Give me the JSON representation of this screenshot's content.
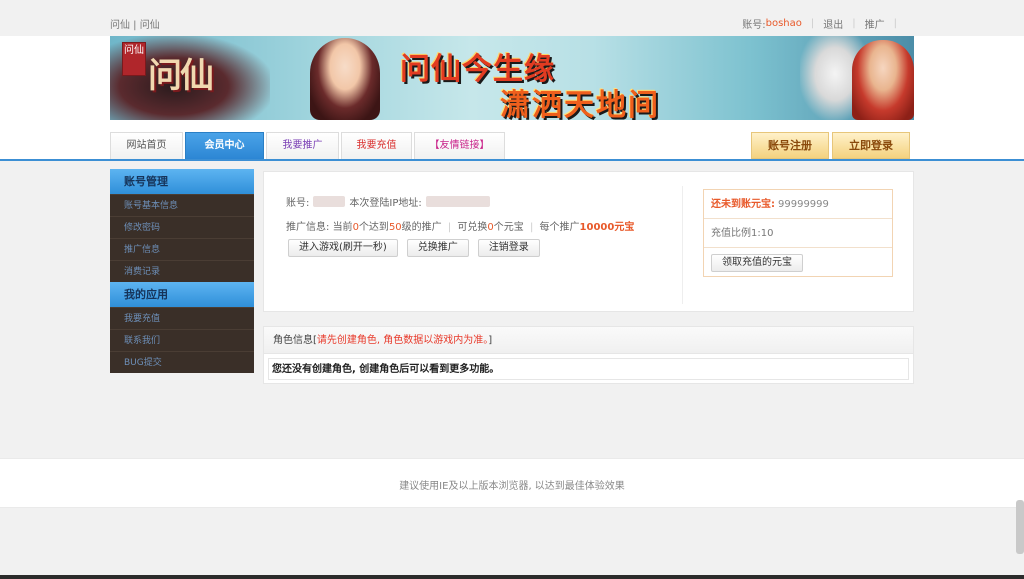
{
  "topbar": {
    "site_links": "问仙 | 问仙",
    "account_prefix": "账号:",
    "username": "boshao",
    "logout": "退出",
    "promote": "推广"
  },
  "banner": {
    "seal_text": "问仙",
    "logo_text": "问仙",
    "slogan1": "问仙今生缘",
    "slogan2": "潇洒天地间"
  },
  "nav": {
    "tabs": [
      {
        "label": "网站首页"
      },
      {
        "label": "会员中心"
      },
      {
        "label": "我要推广"
      },
      {
        "label": "我要充值"
      },
      {
        "label": "【友情链接】"
      }
    ],
    "register": "账号注册",
    "login": "立即登录"
  },
  "sidebar": {
    "section1_title": "账号管理",
    "section1_items": [
      "账号基本信息",
      "修改密码",
      "推广信息",
      "消费记录"
    ],
    "section2_title": "我的应用",
    "section2_items": [
      "我要充值",
      "联系我们",
      "BUG提交"
    ]
  },
  "panel": {
    "account_label": "账号:",
    "ip_label": "本次登陆IP地址:",
    "promo_label": "推广信息:",
    "promo_text1": "当前",
    "promo_count": "0",
    "promo_text2": "个达到",
    "promo_level": "50",
    "promo_text3": "级的推广",
    "redeem_text1": "可兑换",
    "redeem_count": "0",
    "redeem_text2": "个元宝",
    "per_text": "每个推广",
    "per_amount": "10000元宝",
    "btn_enter": "进入游戏(刷开一秒)",
    "btn_exchange": "兑换推广",
    "btn_logout": "注销登录",
    "unclaimed_label": "还未到账元宝:",
    "unclaimed_value": "99999999",
    "ratio_label": "充值比例1:10",
    "btn_claim": "领取充值的元宝"
  },
  "role": {
    "title_prefix": "角色信息[",
    "title_warning": "请先创建角色, 角色数据以游戏内为准。",
    "title_suffix": "]",
    "body": "您还没有创建角色, 创建角色后可以看到更多功能。"
  },
  "footer": {
    "note": "建议使用IE及以上版本浏览器, 以达到最佳体验效果"
  }
}
